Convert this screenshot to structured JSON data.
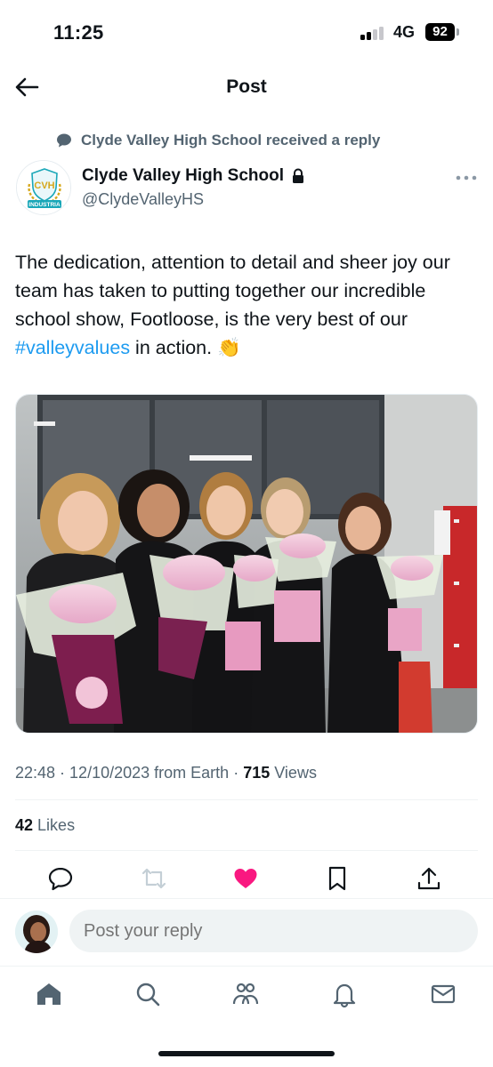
{
  "status_bar": {
    "time": "11:25",
    "network": "4G",
    "battery": "92"
  },
  "header": {
    "title": "Post",
    "back_icon": "arrow-left-icon"
  },
  "context": {
    "icon": "speech-bubble-icon",
    "text": "Clyde Valley High School received a reply"
  },
  "author": {
    "name": "Clyde Valley High School",
    "handle": "@ClydeValleyHS",
    "badge_icon": "lock-icon",
    "avatar_initials": "CVH",
    "avatar_banner": "INDUSTRIA",
    "more_icon": "more-dots-icon"
  },
  "post": {
    "text_before": "The dedication, attention to detail and sheer joy our team has taken to putting together our incredible school show, Footloose, is the very best of our ",
    "hashtag": "#valleyvalues",
    "text_after": " in action. ",
    "emoji": "👏"
  },
  "meta": {
    "time": "22:48",
    "separator": " · ",
    "date": "12/10/2023",
    "source": "from Earth",
    "views_count": "715",
    "views_label": "Views"
  },
  "likes": {
    "count": "42",
    "label": "Likes"
  },
  "actions": {
    "reply_icon": "reply-icon",
    "repost_icon": "repost-icon",
    "like_icon": "heart-filled-icon",
    "bookmark_icon": "bookmark-icon",
    "share_icon": "share-icon"
  },
  "reply": {
    "placeholder": "Post your reply"
  },
  "tabbar": [
    "home-icon",
    "search-icon",
    "communities-icon",
    "notifications-icon",
    "messages-icon"
  ],
  "colors": {
    "accent": "#1d9bf0",
    "like": "#f91880",
    "muted": "#536471",
    "text": "#0f1419"
  }
}
